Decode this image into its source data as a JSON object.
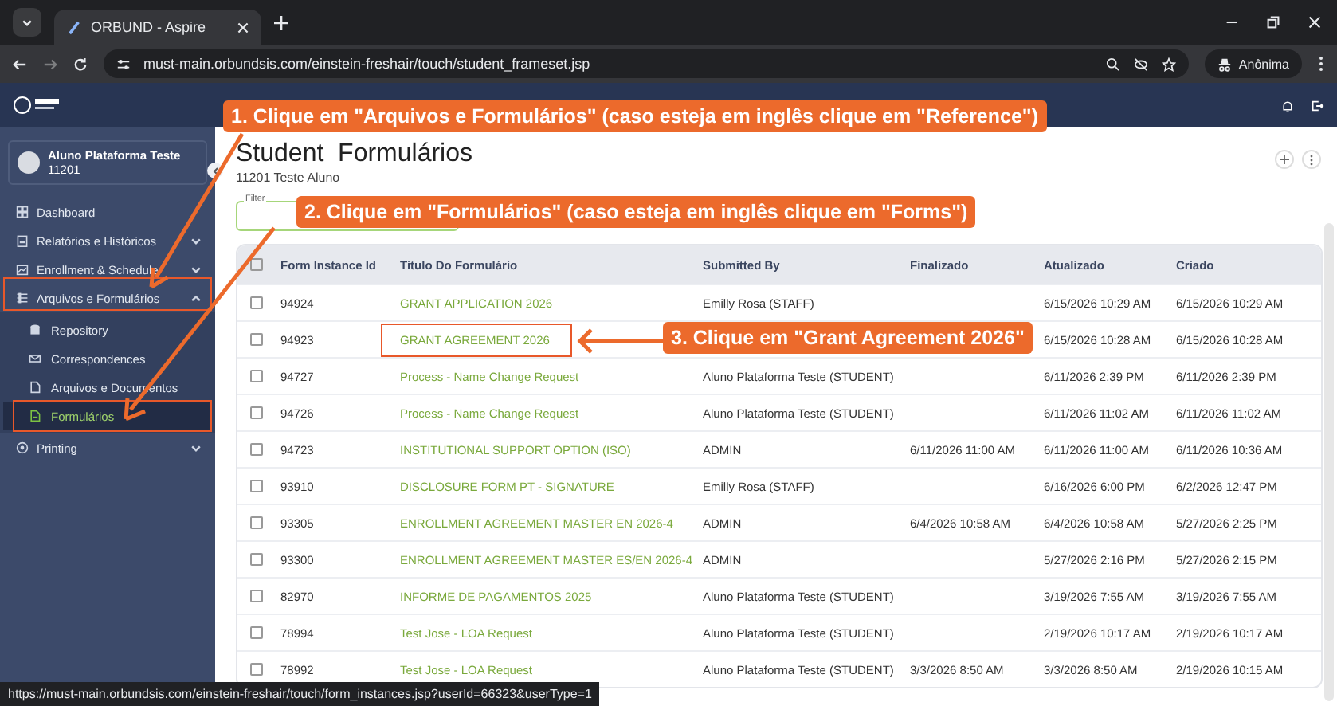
{
  "browser": {
    "tab_title": "ORBUND - Aspire",
    "url": "must-main.orbundsis.com/einstein-freshair/touch/student_frameset.jsp",
    "profile": "Anônima"
  },
  "user": {
    "name": "Aluno Plataforma Teste",
    "id": "11201"
  },
  "nav": [
    {
      "label": "Dashboard",
      "selected": false
    },
    {
      "label": "Relatórios e Históricos",
      "expanded": false,
      "selected": false
    },
    {
      "label": "Enrollment & Schedule",
      "expanded": false,
      "selected": false
    },
    {
      "label": "Arquivos e Formulários",
      "expanded": true,
      "selected": false,
      "children": [
        {
          "label": "Repository",
          "selected": false
        },
        {
          "label": "Correspondences",
          "selected": false
        },
        {
          "label": "Arquivos e Documentos",
          "selected": false
        },
        {
          "label": "Formulários",
          "selected": true
        }
      ]
    },
    {
      "label": "Printing",
      "expanded": false,
      "selected": false
    }
  ],
  "page": {
    "title": "Student  Formulários",
    "subtitle": "11201 Teste Aluno"
  },
  "filter": {
    "label": "Filter"
  },
  "table": {
    "columns": [
      "Form Instance Id",
      "Titulo Do Formulário",
      "Submitted By",
      "Finalizado",
      "Atualizado",
      "Criado"
    ],
    "header_checked": false,
    "rows": [
      {
        "checked": false,
        "cells": [
          "94924",
          "GRANT APPLICATION 2026",
          "Emilly Rosa (STAFF)",
          "",
          "6/15/2026 10:29 AM",
          "6/15/2026 10:29 AM"
        ]
      },
      {
        "checked": false,
        "cells": [
          "94923",
          "GRANT AGREEMENT 2026",
          "",
          "",
          "6/15/2026 10:28 AM",
          "6/15/2026 10:28 AM"
        ]
      },
      {
        "checked": false,
        "cells": [
          "94727",
          "Process - Name Change Request",
          "Aluno Plataforma Teste (STUDENT)",
          "",
          "6/11/2026 2:39 PM",
          "6/11/2026 2:39 PM"
        ]
      },
      {
        "checked": false,
        "cells": [
          "94726",
          "Process - Name Change Request",
          "Aluno Plataforma Teste (STUDENT)",
          "",
          "6/11/2026 11:02 AM",
          "6/11/2026 11:02 AM"
        ]
      },
      {
        "checked": false,
        "cells": [
          "94723",
          "INSTITUTIONAL SUPPORT OPTION (ISO)",
          "ADMIN",
          "6/11/2026 11:00 AM",
          "6/11/2026 11:00 AM",
          "6/11/2026 10:36 AM"
        ]
      },
      {
        "checked": false,
        "cells": [
          "93910",
          "DISCLOSURE FORM PT - SIGNATURE",
          "Emilly Rosa (STAFF)",
          "",
          "6/16/2026 6:00 PM",
          "6/2/2026 12:47 PM"
        ]
      },
      {
        "checked": false,
        "cells": [
          "93305",
          "ENROLLMENT AGREEMENT MASTER EN 2026-4",
          "ADMIN",
          "6/4/2026 10:58 AM",
          "6/4/2026 10:58 AM",
          "5/27/2026 2:25 PM"
        ]
      },
      {
        "checked": false,
        "cells": [
          "93300",
          "ENROLLMENT AGREEMENT MASTER ES/EN 2026-4",
          "ADMIN",
          "",
          "5/27/2026 2:16 PM",
          "5/27/2026 2:15 PM"
        ]
      },
      {
        "checked": false,
        "cells": [
          "82970",
          "INFORME DE PAGAMENTOS 2025",
          "Aluno Plataforma Teste (STUDENT)",
          "",
          "3/19/2026 7:55 AM",
          "3/19/2026 7:55 AM"
        ]
      },
      {
        "checked": false,
        "cells": [
          "78994",
          "Test Jose - LOA Request",
          "Aluno Plataforma Teste (STUDENT)",
          "",
          "2/19/2026 10:17 AM",
          "2/19/2026 10:17 AM"
        ]
      },
      {
        "checked": false,
        "cells": [
          "78992",
          "Test Jose - LOA Request",
          "Aluno Plataforma Teste (STUDENT)",
          "3/3/2026 8:50 AM",
          "3/3/2026 8:50 AM",
          "2/19/2026 10:15 AM"
        ]
      }
    ]
  },
  "status_url": "https://must-main.orbundsis.com/einstein-freshair/touch/form_instances.jsp?userId=66323&userType=1",
  "callouts": [
    {
      "text": "1. Clique em \"Arquivos e Formulários\" (caso esteja em inglês clique em \"Reference\")"
    },
    {
      "text": "2. Clique em \"Formulários\" (caso esteja em inglês clique em \"Forms\")"
    },
    {
      "text": "3. Clique em \"Grant Agreement 2026\""
    }
  ]
}
